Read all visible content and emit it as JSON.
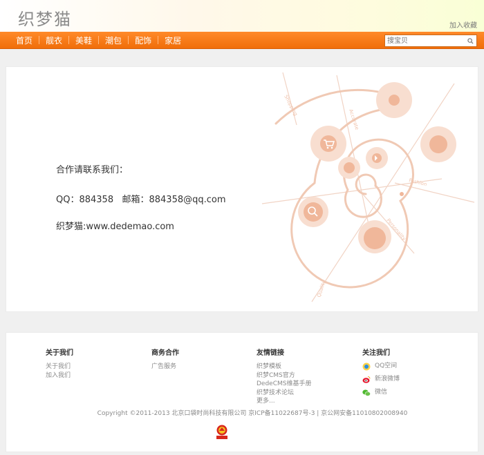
{
  "header": {
    "logo_text": "织梦猫",
    "favorite_link": "加入收藏"
  },
  "nav": {
    "items": [
      {
        "label": "首页"
      },
      {
        "label": "靓衣"
      },
      {
        "label": "美鞋"
      },
      {
        "label": "潮包"
      },
      {
        "label": "配饰"
      },
      {
        "label": "家居"
      }
    ],
    "search_placeholder": "搜宝贝"
  },
  "main": {
    "line1": "合作请联系我们：",
    "line2": "QQ：884358   邮箱：884358@qq.com",
    "line3": "织梦猫:www.dedemao.com",
    "spiral_labels": [
      "Shopping",
      "Accurate",
      "Fashion",
      "Personality",
      "Quality"
    ]
  },
  "footer": {
    "columns": [
      {
        "title": "关于我们",
        "links": [
          "关于我们",
          "加入我们"
        ]
      },
      {
        "title": "商务合作",
        "links": [
          "广告服务"
        ]
      },
      {
        "title": "友情链接",
        "links": [
          "织梦模板",
          "织梦CMS官方",
          "DedeCMS维基手册",
          "织梦技术论坛",
          "更多..."
        ]
      },
      {
        "title": "关注我们",
        "links": [
          "QQ空间",
          "新浪微博",
          "微信"
        ]
      }
    ],
    "copyright": "Copyright ©2011-2013 北京口袋时尚科技有限公司 京ICP备11022687号-3 | 京公网安备11010802008940"
  },
  "colors": {
    "accent": "#f47a1c",
    "spiral": "#f3c9b4"
  }
}
